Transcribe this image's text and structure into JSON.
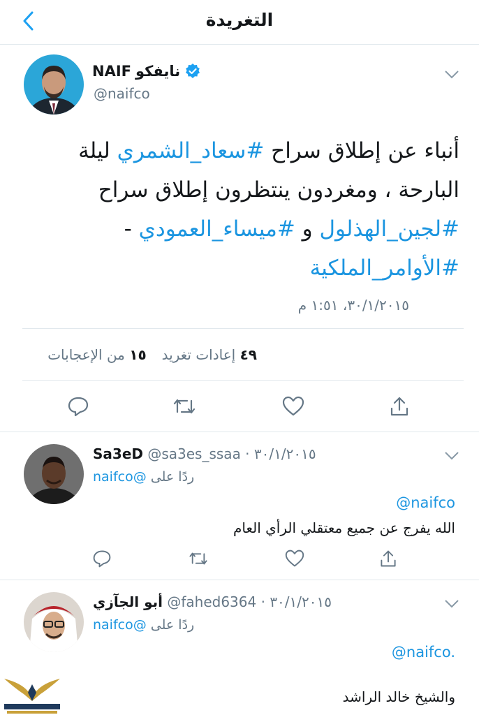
{
  "header": {
    "title": "التغريدة",
    "back_icon": "chevron-left-icon"
  },
  "tweet": {
    "name_ar": "نايفكو",
    "name_en": "NAIF",
    "handle": "@naifco",
    "verified": true,
    "lines": [
      {
        "plain_before": "أنباء عن إطلاق سراح ",
        "tag": "#سعاد_الشمري",
        "plain_after": " ليلة"
      },
      {
        "plain_before": "البارحة ، ومغردون ينتظرون إطلاق سراح",
        "tag": "",
        "plain_after": ""
      },
      {
        "plain_before": "",
        "tag": "#لجين_الهذلول",
        "plain_after": " و ",
        "tag2": "#ميساء_العمودي",
        "plain_end": " -"
      },
      {
        "plain_before": "",
        "tag": "#الأوامر_الملكية",
        "plain_after": ""
      }
    ],
    "timestamp": "٣٠/١/٢٠١٥، ١:٥١ م",
    "stats": {
      "likes_count": "١٥",
      "likes_label": "من الإعجابات",
      "retweets_count": "٤٩",
      "retweets_label": "إعادات تغريد"
    }
  },
  "replies": [
    {
      "name": "Sa3eD",
      "handle": "@sa3es_ssaa",
      "date": "٣٠/١/٢٠١٥",
      "reply_prefix": "ردًا على",
      "reply_mention": "@naifco",
      "mention_line": "@naifco",
      "body": "الله يفرج عن جميع معتقلي الرأي العام"
    },
    {
      "name": "أبو الجآزي",
      "handle": "@fahed6364",
      "date": "٣٠/١/٢٠١٥",
      "reply_prefix": "ردًا على",
      "reply_mention": "@naifco",
      "mention_line": "@naifco.",
      "body": "والشيخ خالد الراشد"
    }
  ],
  "colors": {
    "link": "#1b95e0",
    "muted": "#657786",
    "divider": "#e1e8ed",
    "verified": "#1da1f2"
  },
  "icons": [
    "reply-icon",
    "retweet-icon",
    "like-icon",
    "share-icon",
    "chevron-down-icon",
    "verified-badge-icon"
  ]
}
